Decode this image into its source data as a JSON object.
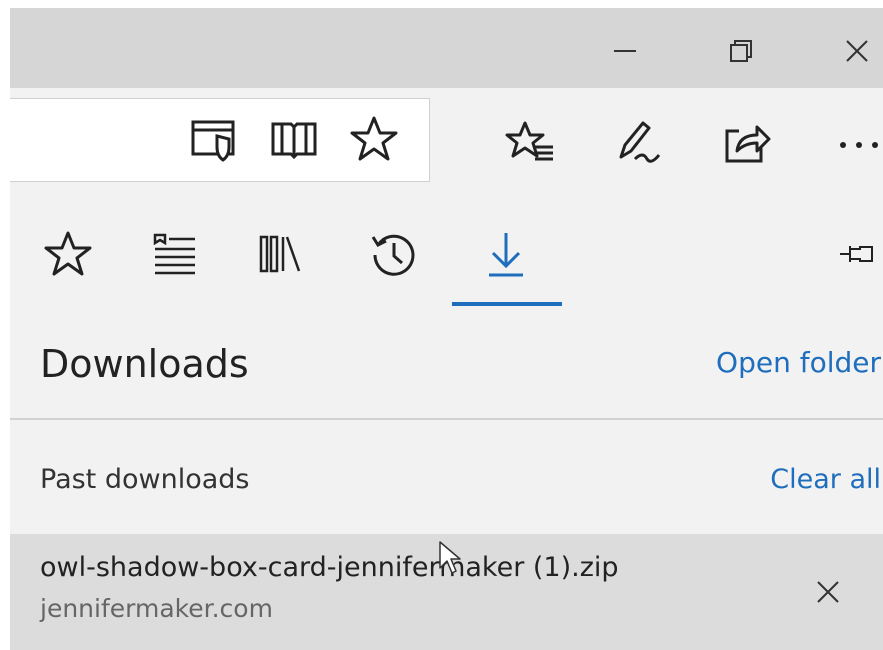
{
  "window": {
    "controls": {
      "minimize_icon": "minimize-icon",
      "restore_icon": "restore-icon",
      "close_icon": "close-icon"
    }
  },
  "toolbar": {
    "address_icons": [
      "tracking-shield-icon",
      "reading-view-icon",
      "favorite-star-icon"
    ],
    "action_icons": [
      "favorites-hub-icon",
      "web-note-icon",
      "share-icon",
      "more-icon"
    ]
  },
  "hub": {
    "tabs": [
      {
        "icon": "favorites-icon"
      },
      {
        "icon": "reading-list-icon"
      },
      {
        "icon": "books-icon"
      },
      {
        "icon": "history-icon"
      },
      {
        "icon": "downloads-icon",
        "active": true
      }
    ],
    "pin_icon": "pin-icon",
    "title": "Downloads",
    "open_folder": "Open folder",
    "past_label": "Past downloads",
    "clear_all": "Clear all",
    "items": [
      {
        "name": "owl-shadow-box-card-jennifermaker (1).zip",
        "source": "jennifermaker.com"
      }
    ]
  },
  "colors": {
    "accent": "#1f6ebd",
    "titlebar": "#d6d6d6",
    "pane": "#f2f2f2",
    "item_hover": "#dcdcdc"
  }
}
